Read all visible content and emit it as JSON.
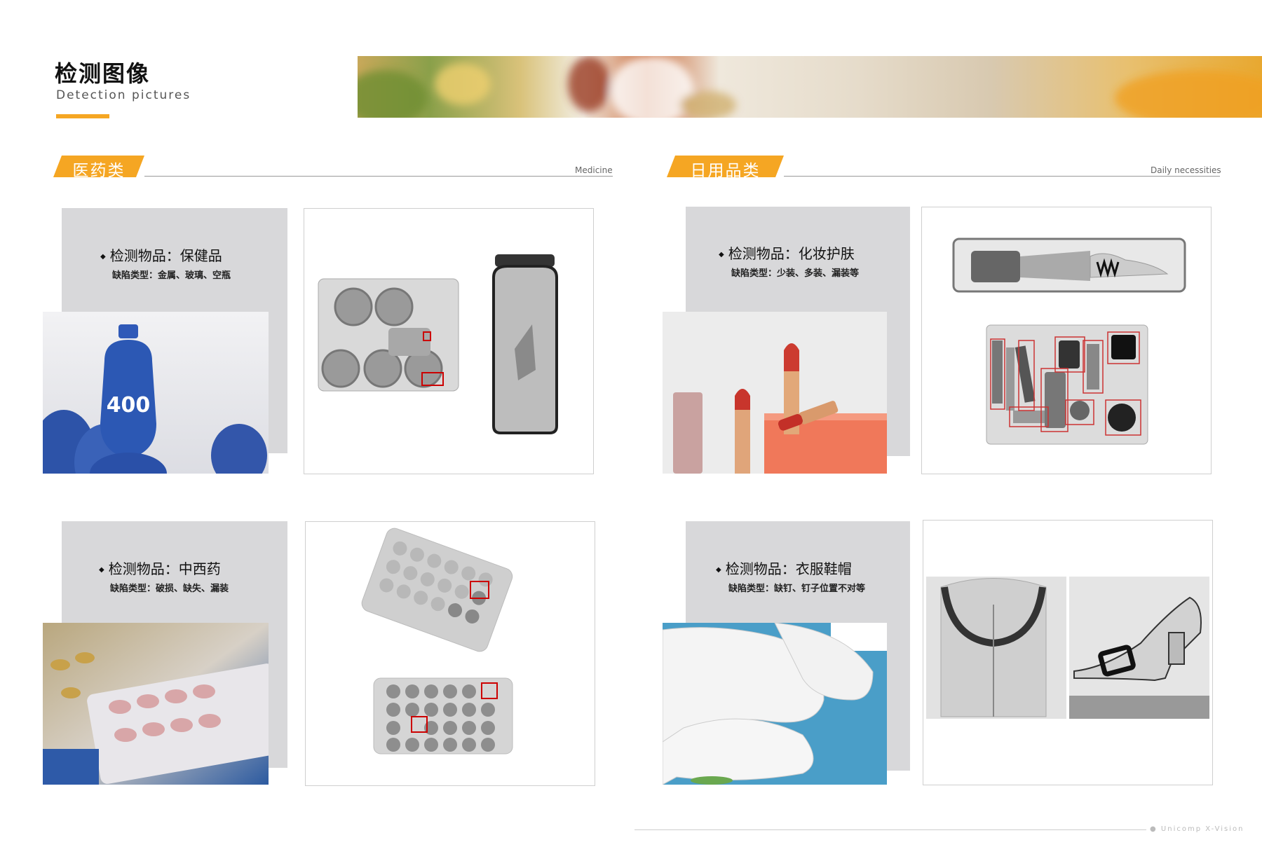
{
  "header": {
    "title_cn": "检测图像",
    "title_en": "Detection pictures",
    "accent_color": "#f5a623"
  },
  "sections": [
    {
      "tag": "医药类",
      "en": "Medicine",
      "items": [
        {
          "title": "检测物品：保健品",
          "defects": "缺陷类型：金属、玻璃、空瓶",
          "photo_text": "400"
        },
        {
          "title": "检测物品：中西药",
          "defects": "缺陷类型：破损、缺失、漏装"
        }
      ]
    },
    {
      "tag": "日用品类",
      "en": "Daily necessities",
      "items": [
        {
          "title": "检测物品：化妆护肤",
          "defects": "缺陷类型：少装、多装、漏装等"
        },
        {
          "title": "检测物品：衣服鞋帽",
          "defects": "缺陷类型：缺钉、钉子位置不对等"
        }
      ]
    }
  ],
  "footer": {
    "brand": "Unicomp X-Vision"
  }
}
